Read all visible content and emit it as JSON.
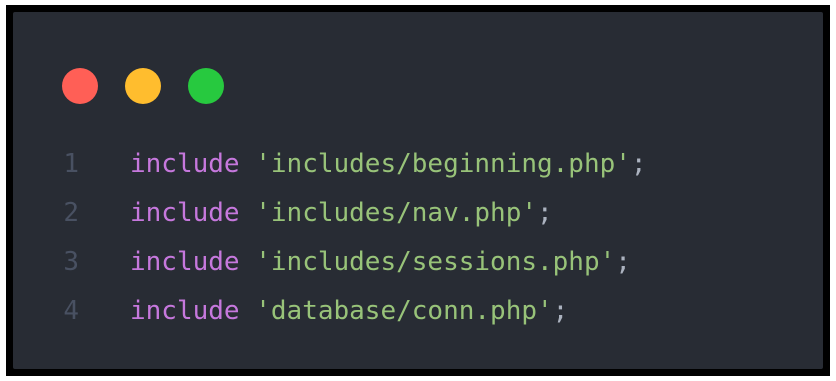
{
  "window": {
    "controls": [
      {
        "name": "close",
        "color": "#ff5f56"
      },
      {
        "name": "minimize",
        "color": "#ffbd2e"
      },
      {
        "name": "maximize",
        "color": "#27c93f"
      }
    ]
  },
  "theme": {
    "background": "#282c34",
    "keyword": "#c678dd",
    "string": "#98c379",
    "punctuation": "#abb2bf",
    "line_number": "#495162"
  },
  "code": {
    "lines": [
      {
        "number": "1",
        "keyword": "include",
        "string": "'includes/beginning.php'",
        "end": ";"
      },
      {
        "number": "2",
        "keyword": "include",
        "string": "'includes/nav.php'",
        "end": ";"
      },
      {
        "number": "3",
        "keyword": "include",
        "string": "'includes/sessions.php'",
        "end": ";"
      },
      {
        "number": "4",
        "keyword": "include",
        "string": "'database/conn.php'",
        "end": ";"
      }
    ]
  }
}
